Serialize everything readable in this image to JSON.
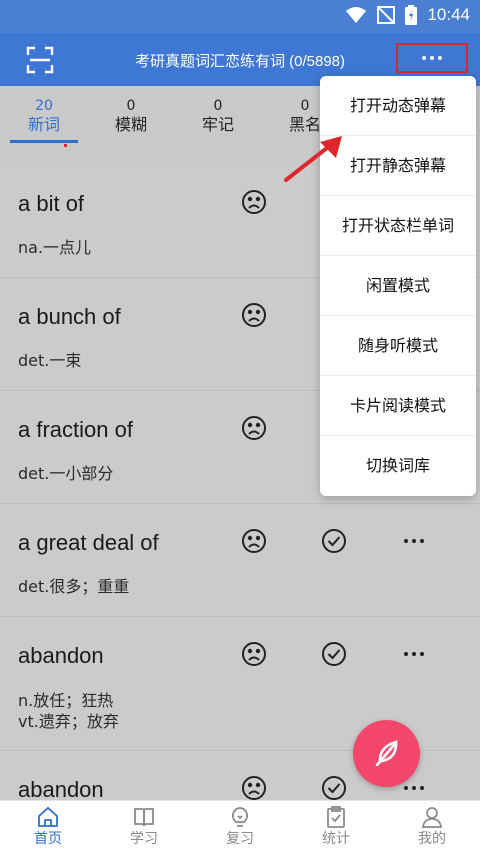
{
  "status_bar": {
    "time": "10:44"
  },
  "header": {
    "title": "考研真题词汇恋练有词 (0/5898)"
  },
  "tabs": [
    {
      "count": "20",
      "label": "新词",
      "active": true
    },
    {
      "count": "0",
      "label": "模糊"
    },
    {
      "count": "0",
      "label": "牢记"
    },
    {
      "count": "0",
      "label": "黑名"
    }
  ],
  "words": [
    {
      "word": "a bit of",
      "def1": "na.一点儿",
      "def2": ""
    },
    {
      "word": "a bunch of",
      "def1": "det.一束",
      "def2": ""
    },
    {
      "word": "a fraction of",
      "def1": "det.一小部分",
      "def2": ""
    },
    {
      "word": "a great deal of",
      "def1": "det.很多；重重",
      "def2": ""
    },
    {
      "word": "abandon",
      "def1": "n.放任；狂热",
      "def2": "vt.遗弃；放弃"
    },
    {
      "word": "abandon",
      "def1": "",
      "def2": ""
    }
  ],
  "menu": {
    "items": [
      "打开动态弹幕",
      "打开静态弹幕",
      "打开状态栏单词",
      "闲置模式",
      "随身听模式",
      "卡片阅读模式",
      "切换词库"
    ]
  },
  "bottom_nav": [
    {
      "label": "首页",
      "icon": "home-icon",
      "active": true
    },
    {
      "label": "学习",
      "icon": "book-icon"
    },
    {
      "label": "复习",
      "icon": "bulb-icon"
    },
    {
      "label": "统计",
      "icon": "clipboard-icon"
    },
    {
      "label": "我的",
      "icon": "person-icon"
    }
  ],
  "colors": {
    "header": "#3f78d4",
    "accent": "#2f6fd0",
    "fab": "#f2476a",
    "highlight": "#e0262d"
  }
}
